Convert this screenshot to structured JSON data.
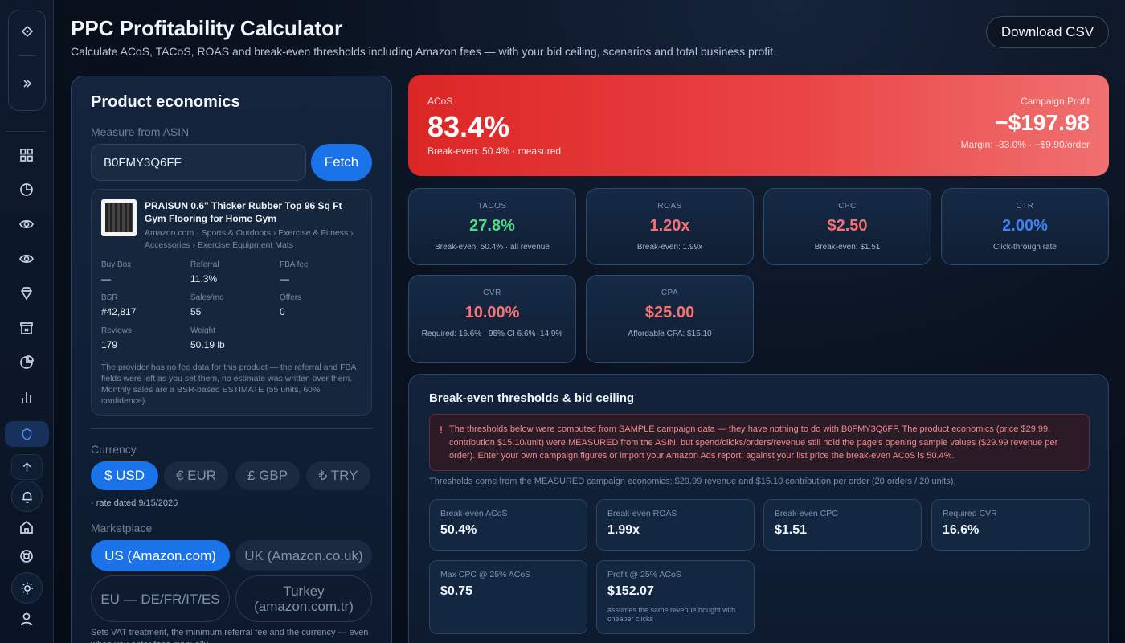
{
  "header": {
    "title": "PPC Profitability Calculator",
    "subtitle": "Calculate ACoS, TACoS, ROAS and break-even thresholds including Amazon fees — with your bid ceiling, scenarios and total business profit.",
    "download_label": "Download CSV"
  },
  "sidebar": {
    "top_icons": [
      "diamond-icon",
      "chevrons-right-icon"
    ],
    "nav_icons": [
      "grid-icon",
      "pie-chart-icon",
      "eye-icon",
      "eye-icon",
      "gem-icon",
      "shopping-cart-icon",
      "pie-chart-icon",
      "bar-chart-icon"
    ],
    "bottom_icons": [
      "shield-icon",
      "arrow-up-icon",
      "bell-icon",
      "home-icon",
      "lifebuoy-icon",
      "sun-icon",
      "user-icon"
    ],
    "active_color": "#4f8ef0"
  },
  "product": {
    "heading": "Product economics",
    "measure_label": "Measure from ASIN",
    "asin_value": "B0FMY3Q6FF",
    "fetch_label": "Fetch",
    "title": "PRAISUN 0.6\" Thicker Rubber Top 96 Sq Ft Gym Flooring for Home Gym",
    "breadcrumb": "Amazon.com · Sports & Outdoors › Exercise & Fitness › Accessories › Exercise Equipment Mats",
    "stats": [
      {
        "label": "Buy Box",
        "value": "—"
      },
      {
        "label": "Referral",
        "value": "11.3%"
      },
      {
        "label": "FBA fee",
        "value": "—"
      },
      {
        "label": "BSR",
        "value": "#42,817"
      },
      {
        "label": "Sales/mo",
        "value": "55"
      },
      {
        "label": "Offers",
        "value": "0"
      },
      {
        "label": "Reviews",
        "value": "179"
      },
      {
        "label": "Weight",
        "value": "50.19 lb"
      }
    ],
    "note": "The provider has no fee data for this product — the referral and FBA fields were left as you set them, no estimate was written over them. Monthly sales are a BSR-based ESTIMATE (55 units, 60% confidence)."
  },
  "currency": {
    "label": "Currency",
    "options": [
      "$ USD",
      "€ EUR",
      "£ GBP",
      "₺ TRY"
    ],
    "selected": "$ USD",
    "rate_note": "· rate dated 9/15/2026"
  },
  "marketplace": {
    "label": "Marketplace",
    "options": [
      "US (Amazon.com)",
      "UK (Amazon.co.uk)",
      "EU — DE/FR/IT/ES",
      "Turkey (amazon.com.tr)"
    ],
    "selected": "US (Amazon.com)",
    "note": "Sets VAT treatment, the minimum referral fee and the currency — even when you enter fees manually."
  },
  "acos_banner": {
    "label": "ACoS",
    "value": "83.4%",
    "sub": "Break-even: 50.4% · measured",
    "profit_label": "Campaign Profit",
    "profit_value": "−$197.98",
    "profit_sub": "Margin: -33.0% · −$9.90/order",
    "color": "#dc2626"
  },
  "metrics": [
    {
      "label": "TACOS",
      "value": "27.8%",
      "sub": "Break-even: 50.4% · all revenue",
      "color": "#4ade80"
    },
    {
      "label": "ROAS",
      "value": "1.20x",
      "sub": "Break-even: 1.99x",
      "color": "#f87171"
    },
    {
      "label": "CPC",
      "value": "$2.50",
      "sub": "Break-even: $1.51",
      "color": "#f87171"
    },
    {
      "label": "CTR",
      "value": "2.00%",
      "sub": "Click-through rate",
      "color": "#3b82f6"
    },
    {
      "label": "CVR",
      "value": "10.00%",
      "sub": "Required: 16.6% · 95% CI 6.6%–14.9%",
      "color": "#f87171"
    },
    {
      "label": "CPA",
      "value": "$25.00",
      "sub": "Affordable CPA: $15.10",
      "color": "#f87171"
    }
  ],
  "breakeven": {
    "title": "Break-even thresholds & bid ceiling",
    "warning_icon": "!",
    "warning": "The thresholds below were computed from SAMPLE campaign data — they have nothing to do with B0FMY3Q6FF. The product economics (price $29.99, contribution $15.10/unit) were MEASURED from the ASIN, but spend/clicks/orders/revenue still hold the page's opening sample values ($29.99 revenue per order). Enter your own campaign figures or import your Amazon Ads report; against your list price the break-even ACoS is 50.4%.",
    "note": "Thresholds come from the MEASURED campaign economics: $29.99 revenue and $15.10 contribution per order (20 orders / 20 units).",
    "cards": [
      {
        "label": "Break-even ACoS",
        "value": "50.4%",
        "sub": ""
      },
      {
        "label": "Break-even ROAS",
        "value": "1.99x",
        "sub": ""
      },
      {
        "label": "Break-even CPC",
        "value": "$1.51",
        "sub": ""
      },
      {
        "label": "Required CVR",
        "value": "16.6%",
        "sub": ""
      },
      {
        "label": "Max CPC @ 25% ACoS",
        "value": "$0.75",
        "sub": ""
      },
      {
        "label": "Profit @ 25% ACoS",
        "value": "$152.07",
        "sub": "assumes the same revenue bought with cheaper clicks"
      }
    ]
  }
}
